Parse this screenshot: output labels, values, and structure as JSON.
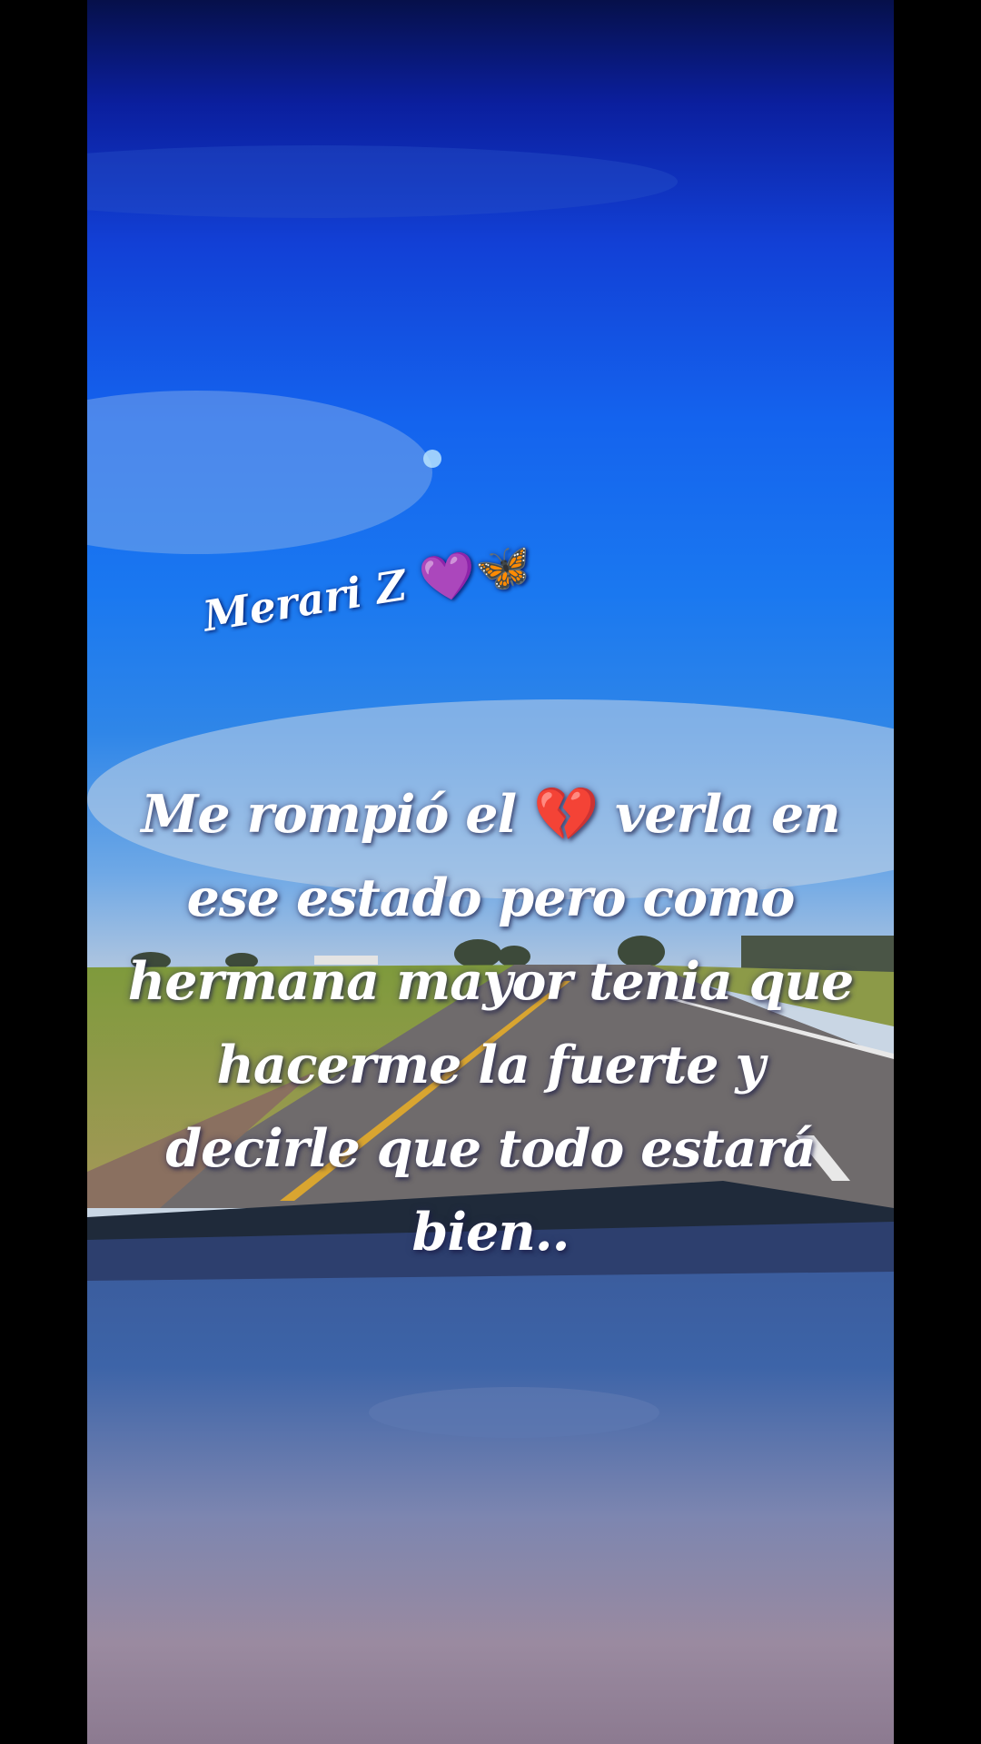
{
  "photo": {
    "subject": "road seen through windshield",
    "sky_top": "#06104a",
    "sky_mid": "#1463ee",
    "horizon": "#c9d6e4",
    "grass": "#8a9a3a",
    "road": "#6f6a6a",
    "dashboard": "#8a7a92"
  },
  "watermark": {
    "name": "Merari Z",
    "emoji": "💜🦋"
  },
  "quote": {
    "line1_before": "Me rompió el ",
    "heart_emoji": "💔",
    "line1_after": " verla en",
    "line2": "ese estado pero como",
    "line3": "hermana mayor tenia que",
    "line4": "hacerme la fuerte y",
    "line5": "decirle que todo estará",
    "line6": "bien.."
  }
}
